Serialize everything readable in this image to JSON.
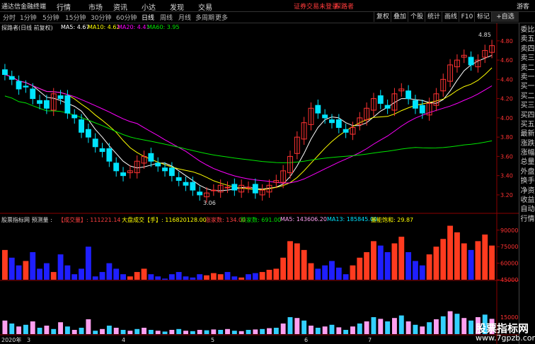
{
  "menu": {
    "app_title": "通达信金融终端",
    "items": [
      "行情",
      "市场",
      "资讯",
      "小达",
      "发现",
      "交易"
    ],
    "warning": "证券交易未登录",
    "user": "探路者",
    "guest": "游客"
  },
  "periods": [
    "分时",
    "1分钟",
    "5分钟",
    "15分钟",
    "30分钟",
    "60分钟",
    "日线",
    "周线",
    "月线",
    "多周期",
    "更多"
  ],
  "active_period": "日线",
  "toolbar": [
    "复权",
    "叠加",
    "个股",
    "统计",
    "画线",
    "F10",
    "标记",
    "+自选"
  ],
  "stock": {
    "title": "探路者(日线 前复权)",
    "ma5": "MA5: 4.67",
    "ma10": "MA10: 4.62",
    "ma20": "MA20: 4.41",
    "ma60": "MA60: 3.95",
    "high_label": "4.85",
    "low_label": "3.06"
  },
  "price_axis": [
    "4.80",
    "4.60",
    "4.40",
    "4.20",
    "4.00",
    "3.80",
    "3.60",
    "3.40",
    "3.20"
  ],
  "volume_bar": {
    "name": "股票指标网 预测量 : ",
    "vol": "【成交量】: 111221.14",
    "big": "大盘成交【手】: 116820128.00",
    "up": "涨家数: 134.00",
    "down": "跌家数: 691.00",
    "ma5": "MA5: 143606.20",
    "ma13": "MA13: 185845.00",
    "ratio": "量能饱和: 29.87"
  },
  "volume_axis": [
    "90000",
    "75000",
    "60000",
    "45000"
  ],
  "lower_axis": [
    "15000"
  ],
  "date_labels": [
    "2020年",
    "3",
    "4",
    "5",
    "6",
    "7"
  ],
  "side_panel": [
    "委比",
    "卖五",
    "卖四",
    "卖三",
    "卖二",
    "卖一",
    "买一",
    "买二",
    "买三",
    "买四",
    "买五",
    "最新",
    "涨跌",
    "涨幅",
    "总量",
    "外盘",
    "换手",
    "净资",
    "收益",
    "自动",
    "行情"
  ],
  "colors": {
    "up": "#ff3232",
    "down": "#00e4ff",
    "ma5": "#ffffff",
    "ma10": "#ffff00",
    "ma20": "#ff00ff",
    "ma60": "#00e600",
    "vol_up": "#ff3b1f",
    "vol_down": "#1f1fff",
    "pink": "#ff9ff0",
    "cyan": "#33d0ff"
  },
  "watermark": {
    "line1": "股票指标网",
    "line2": "www.7gpzb.com"
  },
  "chart_data": {
    "type": "candlestick",
    "series_close": [
      4.45,
      4.4,
      4.3,
      4.32,
      4.2,
      4.15,
      4.1,
      4.25,
      4.2,
      4.05,
      4.0,
      3.85,
      3.8,
      3.7,
      3.65,
      3.55,
      3.45,
      3.4,
      3.45,
      3.55,
      3.6,
      3.55,
      3.5,
      3.45,
      3.4,
      3.35,
      3.3,
      3.25,
      3.2,
      3.22,
      3.25,
      3.3,
      3.28,
      3.25,
      3.3,
      3.28,
      3.22,
      3.25,
      3.3,
      3.35,
      3.45,
      3.6,
      3.8,
      3.95,
      4.1,
      4.05,
      4.0,
      3.95,
      3.9,
      3.85,
      3.9,
      4.0,
      4.1,
      4.2,
      4.15,
      4.1,
      4.25,
      4.3,
      4.2,
      4.1,
      4.05,
      4.15,
      4.25,
      4.4,
      4.55,
      4.6,
      4.65,
      4.55,
      4.6,
      4.7,
      4.75
    ],
    "ylim": [
      3.06,
      4.85
    ],
    "volumes": [
      72000,
      65000,
      58000,
      62000,
      70000,
      55000,
      60000,
      52000,
      68000,
      58000,
      50000,
      55000,
      75000,
      48000,
      52000,
      60000,
      55000,
      50000,
      48000,
      52000,
      55000,
      50000,
      48000,
      46000,
      50000,
      52000,
      48000,
      47000,
      50000,
      49000,
      51000,
      50000,
      52000,
      48000,
      47000,
      50000,
      51000,
      52000,
      54000,
      55000,
      65000,
      80000,
      78000,
      72000,
      60000,
      55000,
      58000,
      62000,
      56000,
      50000,
      58000,
      65000,
      70000,
      80000,
      76000,
      70000,
      78000,
      84000,
      70000,
      62000,
      58000,
      68000,
      75000,
      82000,
      94000,
      88000,
      78000,
      72000,
      80000,
      86000,
      76000
    ],
    "vol_ylim": [
      45000,
      95000
    ]
  }
}
